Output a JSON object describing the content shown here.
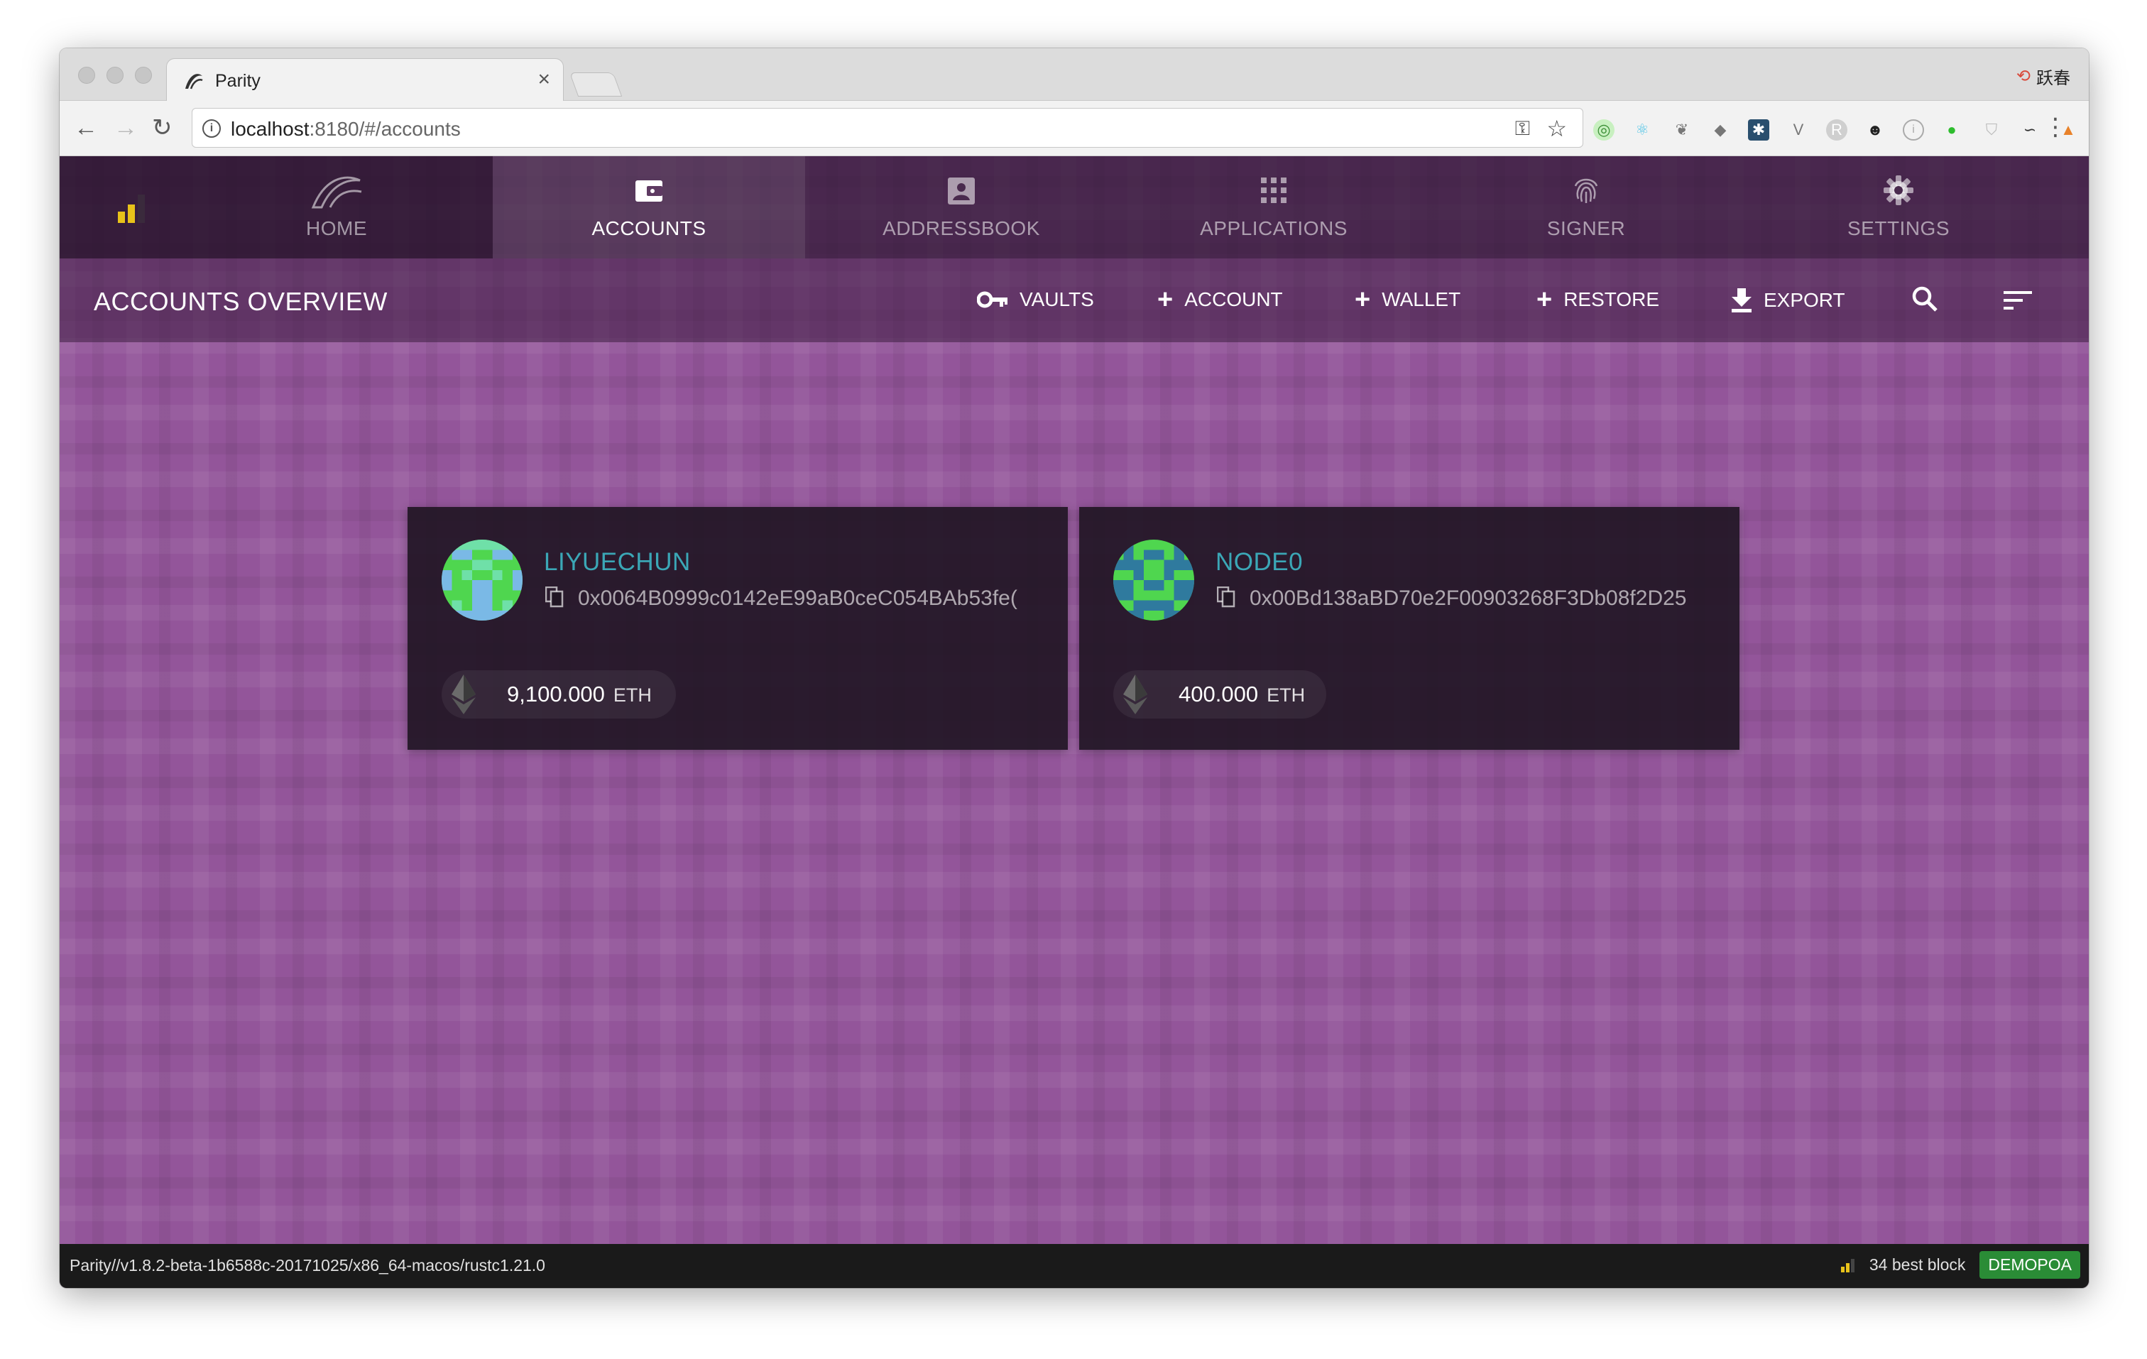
{
  "browser": {
    "tab_title": "Parity",
    "tab_close": "×",
    "profile_name": "跃春",
    "url_host": "localhost",
    "url_rest": ":8180/#/accounts",
    "back": "←",
    "forward": "→",
    "reload": "↻",
    "menu": "⋮"
  },
  "nav": {
    "items": [
      {
        "label": "HOME",
        "icon": "parity-logo-icon"
      },
      {
        "label": "ACCOUNTS",
        "icon": "wallet-icon"
      },
      {
        "label": "ADDRESSBOOK",
        "icon": "contacts-icon"
      },
      {
        "label": "APPLICATIONS",
        "icon": "apps-grid-icon"
      },
      {
        "label": "SIGNER",
        "icon": "fingerprint-icon"
      },
      {
        "label": "SETTINGS",
        "icon": "gear-icon"
      }
    ],
    "active": "ACCOUNTS"
  },
  "subbar": {
    "title": "ACCOUNTS OVERVIEW",
    "actions": {
      "vaults": "VAULTS",
      "account": "ACCOUNT",
      "wallet": "WALLET",
      "restore": "RESTORE",
      "export": "EXPORT"
    }
  },
  "accounts": [
    {
      "name": "LIYUECHUN",
      "address": "0x0064B0999c0142eE99aB0ceC054BAb53fe(",
      "balance": "9,100.000",
      "unit": "ETH"
    },
    {
      "name": "NODE0",
      "address": "0x00Bd138aBD70e2F00903268F3Db08f2D25",
      "balance": "400.000",
      "unit": "ETH"
    }
  ],
  "statusbar": {
    "version": "Parity//v1.8.2-beta-1b6588c-20171025/x86_64-macos/rustc1.21.0",
    "best_block": "34 best block",
    "chain": "DEMOPOA"
  },
  "colors": {
    "background": "#93559a",
    "account_name": "#3ba7b6",
    "chain_badge": "#2a8c36"
  }
}
